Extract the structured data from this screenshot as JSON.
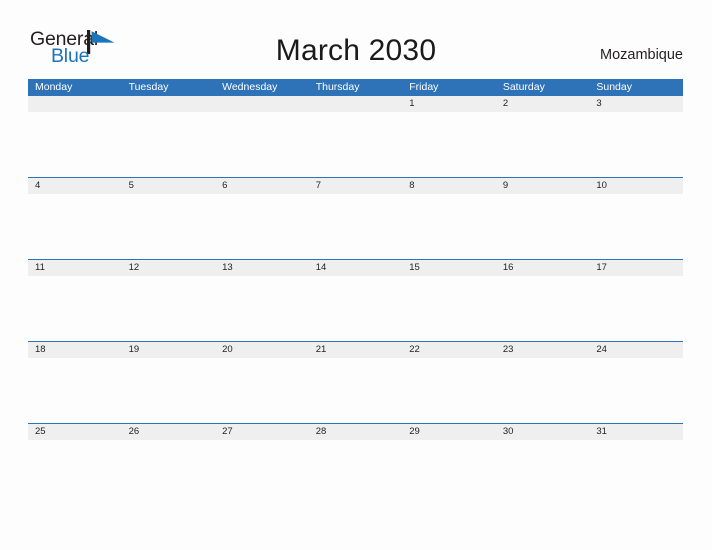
{
  "brand": {
    "name_part1": "General",
    "name_part2": "Blue",
    "color_dark": "#231f20",
    "color_blue": "#1b75bb"
  },
  "header": {
    "title": "March 2030",
    "country": "Mozambique",
    "accent_color": "#2e72b8",
    "band_color": "#efefef"
  },
  "calendar": {
    "month": "March",
    "year": "2030",
    "weekday_headers": [
      "Monday",
      "Tuesday",
      "Wednesday",
      "Thursday",
      "Friday",
      "Saturday",
      "Sunday"
    ],
    "weeks": [
      [
        "",
        "",
        "",
        "",
        "1",
        "2",
        "3"
      ],
      [
        "4",
        "5",
        "6",
        "7",
        "8",
        "9",
        "10"
      ],
      [
        "11",
        "12",
        "13",
        "14",
        "15",
        "16",
        "17"
      ],
      [
        "18",
        "19",
        "20",
        "21",
        "22",
        "23",
        "24"
      ],
      [
        "25",
        "26",
        "27",
        "28",
        "29",
        "30",
        "31"
      ]
    ]
  }
}
